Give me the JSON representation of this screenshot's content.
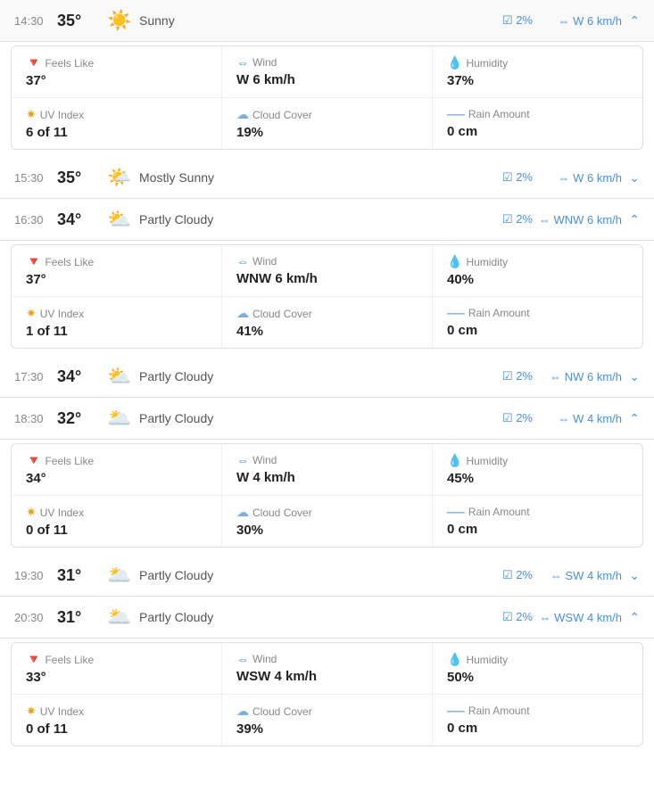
{
  "rows": [
    {
      "time": "14:30",
      "temp": "35°",
      "icon": "☀️",
      "desc": "Sunny",
      "rain": "2%",
      "wind": "W 6 km/h",
      "expanded": true,
      "details": {
        "feels_like_label": "Feels Like",
        "feels_like": "37°",
        "wind_label": "Wind",
        "wind_val": "W 6 km/h",
        "humidity_label": "Humidity",
        "humidity": "37%",
        "uv_label": "UV Index",
        "uv": "6 of 11",
        "cloud_label": "Cloud Cover",
        "cloud": "19%",
        "rain_label": "Rain Amount",
        "rain_val": "0 cm"
      }
    },
    {
      "time": "15:30",
      "temp": "35°",
      "icon": "🌤️",
      "desc": "Mostly Sunny",
      "rain": "2%",
      "wind": "W 6 km/h",
      "expanded": false
    },
    {
      "time": "16:30",
      "temp": "34°",
      "icon": "⛅",
      "desc": "Partly Cloudy",
      "rain": "2%",
      "wind": "WNW 6 km/h",
      "expanded": true,
      "details": {
        "feels_like_label": "Feels Like",
        "feels_like": "37°",
        "wind_label": "Wind",
        "wind_val": "WNW 6 km/h",
        "humidity_label": "Humidity",
        "humidity": "40%",
        "uv_label": "UV Index",
        "uv": "1 of 11",
        "cloud_label": "Cloud Cover",
        "cloud": "41%",
        "rain_label": "Rain Amount",
        "rain_val": "0 cm"
      }
    },
    {
      "time": "17:30",
      "temp": "34°",
      "icon": "⛅",
      "desc": "Partly Cloudy",
      "rain": "2%",
      "wind": "NW 6 km/h",
      "expanded": false
    },
    {
      "time": "18:30",
      "temp": "32°",
      "icon": "🌥️",
      "desc": "Partly Cloudy",
      "rain": "2%",
      "wind": "W 4 km/h",
      "expanded": true,
      "details": {
        "feels_like_label": "Feels Like",
        "feels_like": "34°",
        "wind_label": "Wind",
        "wind_val": "W 4 km/h",
        "humidity_label": "Humidity",
        "humidity": "45%",
        "uv_label": "UV Index",
        "uv": "0 of 11",
        "cloud_label": "Cloud Cover",
        "cloud": "30%",
        "rain_label": "Rain Amount",
        "rain_val": "0 cm"
      }
    },
    {
      "time": "19:30",
      "temp": "31°",
      "icon": "🌥️",
      "desc": "Partly Cloudy",
      "rain": "2%",
      "wind": "SW 4 km/h",
      "expanded": false
    },
    {
      "time": "20:30",
      "temp": "31°",
      "icon": "🌥️",
      "desc": "Partly Cloudy",
      "rain": "2%",
      "wind": "WSW 4 km/h",
      "expanded": true,
      "details": {
        "feels_like_label": "Feels Like",
        "feels_like": "33°",
        "wind_label": "Wind",
        "wind_val": "WSW 4 km/h",
        "humidity_label": "Humidity",
        "humidity": "50%",
        "uv_label": "UV Index",
        "uv": "0 of 11",
        "cloud_label": "Cloud Cover",
        "cloud": "39%",
        "rain_label": "Rain Amount",
        "rain_val": "0 cm"
      }
    }
  ],
  "labels": {
    "feels_like": "Feels Like",
    "wind": "Wind",
    "humidity": "Humidity",
    "uv_index": "UV Index",
    "cloud_cover": "Cloud Cover",
    "rain_amount": "Rain Amount"
  }
}
